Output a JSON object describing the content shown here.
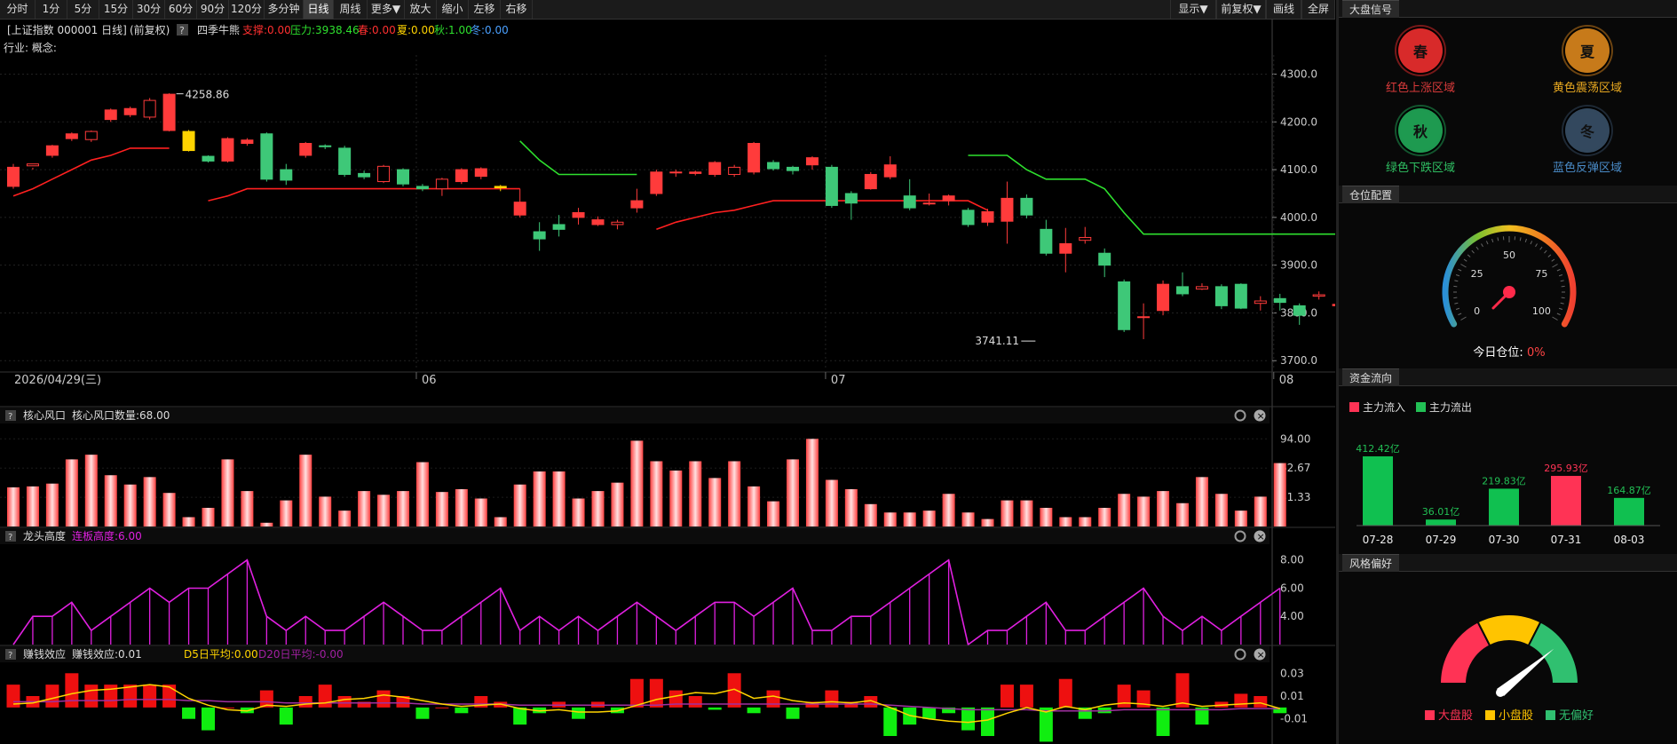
{
  "toolbar": {
    "left_buttons": [
      "分时",
      "1分",
      "5分",
      "15分",
      "30分",
      "60分",
      "90分",
      "120分",
      "多分钟",
      "日线",
      "周线",
      "更多▼",
      "放大",
      "缩小",
      "左移",
      "右移"
    ],
    "active": "日线",
    "right_buttons": [
      "显示▼",
      "前复权▼",
      "画线",
      "全屏"
    ]
  },
  "header": {
    "symbol": "[上证指数 000001 日线]",
    "adjust": "(前复权)",
    "help": "?",
    "indicator": "四季牛熊",
    "support_label": "支撑:0.00",
    "pressure_label": "压力:3938.46",
    "spring_label": "春:0.00",
    "summer_label": "夏:0.00",
    "autumn_label": "秋:1.00",
    "winter_label": "冬:0.00",
    "industry": "行业: 概念:"
  },
  "colors": {
    "up": "#ff3b3b",
    "down": "#3ec878",
    "support": "#ff2020",
    "pressure": "#2ee02e",
    "magenta": "#e020e0",
    "yellow": "#ffd400"
  },
  "chart_data": [
    {
      "type": "candlestick",
      "title": "四季牛熊",
      "ylim": [
        3680,
        4340
      ],
      "yticks": [
        "4300.0",
        "4200.0",
        "4100.0",
        "4000.0",
        "3900.0",
        "3800.0",
        "3700.0"
      ],
      "ytick_values": [
        4300,
        4200,
        4100,
        4000,
        3900,
        3800,
        3700
      ],
      "date_labels": [
        {
          "i": 0,
          "text": "2026/04/29(三)"
        },
        {
          "i": 21,
          "text": "06"
        },
        {
          "i": 42,
          "text": "07"
        },
        {
          "i": 65,
          "text": "08"
        }
      ],
      "high_annotation": {
        "i": 8,
        "text": "4258.86",
        "value": 4258.86
      },
      "low_annotation": {
        "i": 53,
        "text": "3741.11",
        "value": 3741.11
      },
      "candles": [
        [
          4065,
          4105,
          4112,
          4060
        ],
        [
          4108,
          4112,
          4104,
          4100
        ],
        [
          4130,
          4150,
          4152,
          4125
        ],
        [
          4165,
          4175,
          4178,
          4160
        ],
        [
          4163,
          4180,
          4182,
          4158
        ],
        [
          4205,
          4225,
          4228,
          4200
        ],
        [
          4215,
          4228,
          4232,
          4210
        ],
        [
          4210,
          4245,
          4250,
          4205
        ],
        [
          4182,
          4258,
          4260,
          4180
        ],
        [
          4180,
          4140,
          4183,
          4138
        ],
        [
          4128,
          4118,
          4130,
          4115
        ],
        [
          4118,
          4165,
          4168,
          4115
        ],
        [
          4155,
          4162,
          4166,
          4150
        ],
        [
          4175,
          4080,
          4178,
          4075
        ],
        [
          4100,
          4078,
          4112,
          4068
        ],
        [
          4130,
          4155,
          4158,
          4125
        ],
        [
          4150,
          4148,
          4153,
          4143
        ],
        [
          4145,
          4090,
          4150,
          4085
        ],
        [
          4092,
          4085,
          4098,
          4080
        ],
        [
          4075,
          4107,
          4110,
          4072
        ],
        [
          4100,
          4070,
          4103,
          4065
        ],
        [
          4065,
          4060,
          4070,
          4055
        ],
        [
          4060,
          4080,
          4083,
          4045
        ],
        [
          4075,
          4100,
          4103,
          4070
        ],
        [
          4086,
          4102,
          4105,
          4080
        ],
        [
          4065,
          4062,
          4068,
          4055
        ],
        [
          4005,
          4032,
          4060,
          4000
        ],
        [
          3970,
          3955,
          3990,
          3930
        ],
        [
          3985,
          3975,
          4005,
          3960
        ],
        [
          4000,
          4010,
          4020,
          3985
        ],
        [
          3985,
          3995,
          4002,
          3982
        ],
        [
          3985,
          3990,
          3995,
          3975
        ],
        [
          4020,
          4035,
          4060,
          4010
        ],
        [
          4050,
          4095,
          4100,
          4045
        ],
        [
          4095,
          4095,
          4100,
          4085
        ],
        [
          4092,
          4095,
          4098,
          4088
        ],
        [
          4090,
          4115,
          4118,
          4085
        ],
        [
          4090,
          4105,
          4110,
          4085
        ],
        [
          4095,
          4155,
          4158,
          4090
        ],
        [
          4115,
          4102,
          4120,
          4098
        ],
        [
          4105,
          4098,
          4108,
          4090
        ],
        [
          4110,
          4125,
          4128,
          4100
        ],
        [
          4105,
          4025,
          4110,
          4020
        ],
        [
          4050,
          4030,
          4055,
          3995
        ],
        [
          4060,
          4090,
          4095,
          4058
        ],
        [
          4085,
          4110,
          4128,
          4080
        ],
        [
          4045,
          4020,
          4080,
          4015
        ],
        [
          4030,
          4030,
          4050,
          4025
        ],
        [
          4035,
          4045,
          4048,
          4025
        ],
        [
          4015,
          3985,
          4020,
          3980
        ],
        [
          3990,
          4012,
          4018,
          3982
        ],
        [
          3992,
          4040,
          4075,
          3945
        ],
        [
          4040,
          4005,
          4048,
          3998
        ],
        [
          3975,
          3925,
          3995,
          3920
        ],
        [
          3925,
          3945,
          3978,
          3885
        ],
        [
          3952,
          3958,
          3980,
          3945
        ],
        [
          3925,
          3900,
          3935,
          3875
        ],
        [
          3865,
          3765,
          3870,
          3760
        ],
        [
          3792,
          3792,
          3820,
          3745
        ],
        [
          3805,
          3860,
          3868,
          3795
        ],
        [
          3855,
          3840,
          3885,
          3835
        ],
        [
          3850,
          3855,
          3862,
          3848
        ],
        [
          3855,
          3815,
          3860,
          3808
        ],
        [
          3860,
          3810,
          3862,
          3808
        ],
        [
          3820,
          3825,
          3835,
          3805
        ],
        [
          3830,
          3822,
          3840,
          3805
        ],
        [
          3815,
          3795,
          3820,
          3775
        ],
        [
          3835,
          3838,
          3845,
          3828
        ],
        [
          3815,
          3818,
          3822,
          3810
        ]
      ],
      "support_line": [
        4045,
        4060,
        4080,
        4100,
        4120,
        4130,
        4145,
        4145,
        4145,
        null,
        4035,
        4045,
        4060,
        4060,
        4060,
        4060,
        4060,
        4060,
        4060,
        4060,
        4060,
        4060,
        4060,
        4060,
        4060,
        4060,
        4060,
        null,
        null,
        null,
        null,
        null,
        null,
        3975,
        3990,
        4000,
        4010,
        4015,
        4025,
        4035,
        4035,
        4035,
        4035,
        4035,
        4035,
        4035,
        4035,
        4035,
        4035,
        4035,
        4015
      ],
      "support_offset": [
        0,
        10
      ],
      "pressure_segments": [
        {
          "start": 26,
          "values": [
            4160,
            4120,
            4090,
            4090,
            4090,
            4090,
            4090
          ]
        },
        {
          "start": 49,
          "values": [
            4130,
            4130,
            4130,
            4100,
            4080,
            4080,
            4080,
            4060,
            4010,
            3965,
            3965,
            3965,
            3965,
            3965,
            3965,
            3965,
            3965,
            3965,
            3965,
            3965,
            3950,
            3940
          ]
        }
      ],
      "yellow_candles": [
        9,
        25
      ]
    },
    {
      "type": "bar",
      "title": "核心风口",
      "value_label": "核心风口数量:68.00",
      "ylim": [
        0,
        100
      ],
      "yticks": [
        "94.00",
        "62.67",
        "31.33"
      ],
      "ytick_values": [
        94,
        62.67,
        31.33
      ],
      "values": [
        42,
        43,
        46,
        72,
        77,
        55,
        45,
        53,
        36,
        10,
        20,
        72,
        38,
        4,
        28,
        77,
        32,
        17,
        38,
        34,
        38,
        69,
        37,
        40,
        30,
        10,
        45,
        59,
        59,
        30,
        38,
        47,
        92,
        70,
        60,
        70,
        52,
        70,
        43,
        27,
        72,
        94,
        50,
        40,
        24,
        15,
        15,
        17,
        35,
        15,
        8,
        28,
        28,
        20,
        10,
        10,
        20,
        35,
        32,
        38,
        25,
        53,
        35,
        17,
        32,
        68
      ]
    },
    {
      "type": "line",
      "title": "龙头高度",
      "value_label": "连板高度:6.00",
      "ylim": [
        2,
        8.8
      ],
      "yticks": [
        "8.00",
        "6.00",
        "4.00"
      ],
      "ytick_values": [
        8,
        6,
        4
      ],
      "values": [
        2,
        4,
        4,
        5,
        3,
        4,
        5,
        6,
        5,
        6,
        6,
        7,
        8,
        4,
        3,
        4,
        3,
        3,
        4,
        5,
        4,
        3,
        3,
        4,
        5,
        6,
        3,
        4,
        3,
        4,
        3,
        4,
        5,
        4,
        3,
        4,
        5,
        5,
        4,
        5,
        6,
        3,
        3,
        4,
        4,
        5,
        6,
        7,
        8,
        2,
        3,
        3,
        4,
        5,
        3,
        3,
        4,
        5,
        6,
        4,
        3,
        4,
        3,
        4,
        5,
        6
      ],
      "baseline": 2
    },
    {
      "type": "bar",
      "title": "赚钱效应",
      "value_label": "赚钱效应:0.01",
      "d5_label": "D5日平均:0.00",
      "d20_label": "D20日平均:-0.00",
      "ylim": [
        -0.032,
        0.038
      ],
      "yticks": [
        "0.03",
        "0.01",
        "-0.01"
      ],
      "ytick_values": [
        0.03,
        0.01,
        -0.01
      ],
      "values": [
        0.02,
        0.01,
        0.02,
        0.03,
        0.02,
        0.02,
        0.02,
        0.02,
        0.02,
        -0.01,
        -0.02,
        0,
        -0.005,
        0.015,
        -0.015,
        0.01,
        0.02,
        0.01,
        0.005,
        0.015,
        0.01,
        -0.01,
        0,
        -0.005,
        0.01,
        0.005,
        -0.015,
        -0.005,
        0.005,
        -0.01,
        0.005,
        -0.005,
        0.025,
        0.025,
        0.015,
        0.01,
        -0.002,
        0.03,
        -0.005,
        0.015,
        -0.01,
        0.005,
        0.015,
        0.005,
        0.01,
        -0.025,
        -0.015,
        -0.01,
        -0.005,
        -0.02,
        -0.025,
        0.02,
        0.02,
        -0.03,
        0.025,
        -0.01,
        -0.005,
        0.02,
        0.015,
        -0.025,
        0.03,
        -0.015,
        0.005,
        0.012,
        0.01,
        -0.005
      ],
      "d5": [
        0.003,
        0.004,
        0.008,
        0.012,
        0.015,
        0.016,
        0.018,
        0.02,
        0.018,
        0.008,
        0.002,
        -0.002,
        -0.003,
        0.002,
        0.001,
        0.003,
        0.004,
        0.007,
        0.008,
        0.011,
        0.009,
        0.006,
        0.003,
        0.001,
        0.002,
        0.003,
        -0.001,
        -0.003,
        -0.002,
        -0.004,
        -0.004,
        -0.003,
        0.002,
        0.007,
        0.01,
        0.013,
        0.012,
        0.016,
        0.008,
        0.01,
        0.006,
        0.004,
        0.005,
        0.004,
        0.006,
        0,
        -0.007,
        -0.01,
        -0.012,
        -0.013,
        -0.011,
        -0.005,
        0,
        -0.004,
        0.001,
        -0.002,
        0.002,
        0.004,
        0.003,
        0.001,
        0.004,
        0.001,
        0.002,
        0.003,
        0.004,
        -0.001
      ],
      "d20": [
        0.005,
        0.005,
        0.005,
        0.006,
        0.006,
        0.006,
        0.007,
        0.007,
        0.007,
        0.006,
        0.006,
        0.005,
        0.005,
        0.005,
        0.004,
        0.004,
        0.004,
        0.004,
        0.004,
        0.004,
        0.004,
        0.003,
        0.003,
        0.003,
        0.003,
        0.003,
        0.002,
        0.002,
        0.002,
        0.002,
        0.002,
        0.002,
        0.002,
        0.002,
        0.003,
        0.003,
        0.003,
        0.003,
        0.003,
        0.003,
        0.003,
        0.003,
        0.003,
        0.003,
        0.003,
        0.002,
        0.001,
        0,
        -0.001,
        -0.002,
        -0.002,
        -0.002,
        -0.002,
        -0.003,
        -0.003,
        -0.003,
        -0.003,
        -0.002,
        -0.002,
        -0.002,
        -0.002,
        -0.002,
        -0.002,
        -0.001,
        -0.001,
        -0.001
      ]
    },
    {
      "type": "bar",
      "title": "资金流向",
      "categories": [
        "07-28",
        "07-29",
        "07-30",
        "07-31",
        "08-03"
      ],
      "values": [
        412.42,
        36.01,
        219.83,
        295.93,
        164.87
      ],
      "labels": [
        "412.42亿",
        "36.01亿",
        "219.83亿",
        "295.93亿",
        "164.87亿"
      ],
      "direction": [
        "out",
        "out",
        "out",
        "in",
        "out"
      ],
      "legend": [
        "主力流入",
        "主力流出"
      ]
    },
    {
      "type": "gauge",
      "title": "仓位配置",
      "ticks": [
        "0",
        "25",
        "50",
        "75",
        "100"
      ],
      "value": 0
    }
  ],
  "sidebar": {
    "sec1": "大盘信号",
    "signals": [
      {
        "glyph": "春",
        "label": "红色上涨区域",
        "color": "#d82a2a",
        "text": "#d83a3a"
      },
      {
        "glyph": "夏",
        "label": "黄色震荡区域",
        "color": "#c77a1a",
        "text": "#e8a820"
      },
      {
        "glyph": "秋",
        "label": "绿色下跌区域",
        "color": "#1e9a50",
        "text": "#2fbf62"
      },
      {
        "glyph": "冬",
        "label": "蓝色反弹区域",
        "color": "#33485e",
        "text": "#4a8cc8"
      }
    ],
    "sec2": "仓位配置",
    "today_label": "今日仓位:",
    "today_value": "0%",
    "sec3": "资金流向",
    "sec4": "风格偏好",
    "style_legend": [
      {
        "label": "大盘股",
        "color": "#ff3355"
      },
      {
        "label": "小盘股",
        "color": "#ffc400"
      },
      {
        "label": "无偏好",
        "color": "#30c070"
      }
    ]
  }
}
